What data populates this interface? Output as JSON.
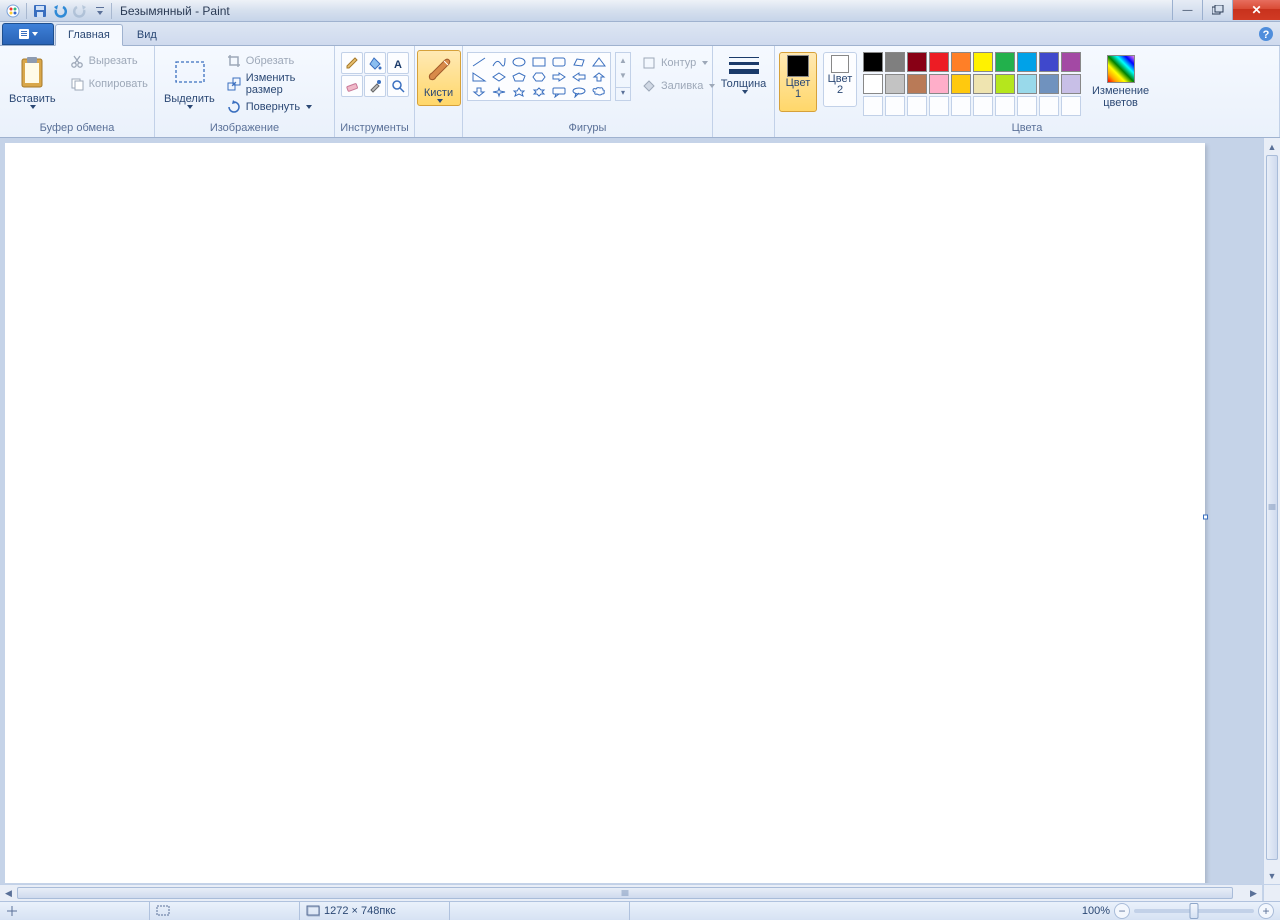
{
  "title": "Безымянный - Paint",
  "tabs": {
    "home": "Главная",
    "view": "Вид"
  },
  "clipboard": {
    "paste": "Вставить",
    "cut": "Вырезать",
    "copy": "Копировать",
    "group": "Буфер обмена"
  },
  "image": {
    "select": "Выделить",
    "crop": "Обрезать",
    "resize": "Изменить размер",
    "rotate": "Повернуть",
    "group": "Изображение"
  },
  "tools": {
    "group": "Инструменты"
  },
  "brushes": {
    "label": "Кисти"
  },
  "shapes": {
    "outline": "Контур",
    "fill": "Заливка",
    "group": "Фигуры"
  },
  "thickness": {
    "label": "Толщина"
  },
  "colors": {
    "color1": "Цвет\n1",
    "color2": "Цвет\n2",
    "edit": "Изменение\nцветов",
    "group": "Цвета",
    "slot1": "#000000",
    "slot2": "#ffffff",
    "palette_row1": [
      "#000000",
      "#7f7f7f",
      "#880015",
      "#ed1c24",
      "#ff7f27",
      "#fff200",
      "#22b14c",
      "#00a2e8",
      "#3f48cc",
      "#a349a4"
    ],
    "palette_row2": [
      "#ffffff",
      "#c3c3c3",
      "#b97a57",
      "#ffaec9",
      "#ffc90e",
      "#efe4b0",
      "#b5e61d",
      "#99d9ea",
      "#7092be",
      "#c8bfe7"
    ]
  },
  "status": {
    "size": "1272 × 748пкс",
    "zoom": "100%"
  }
}
